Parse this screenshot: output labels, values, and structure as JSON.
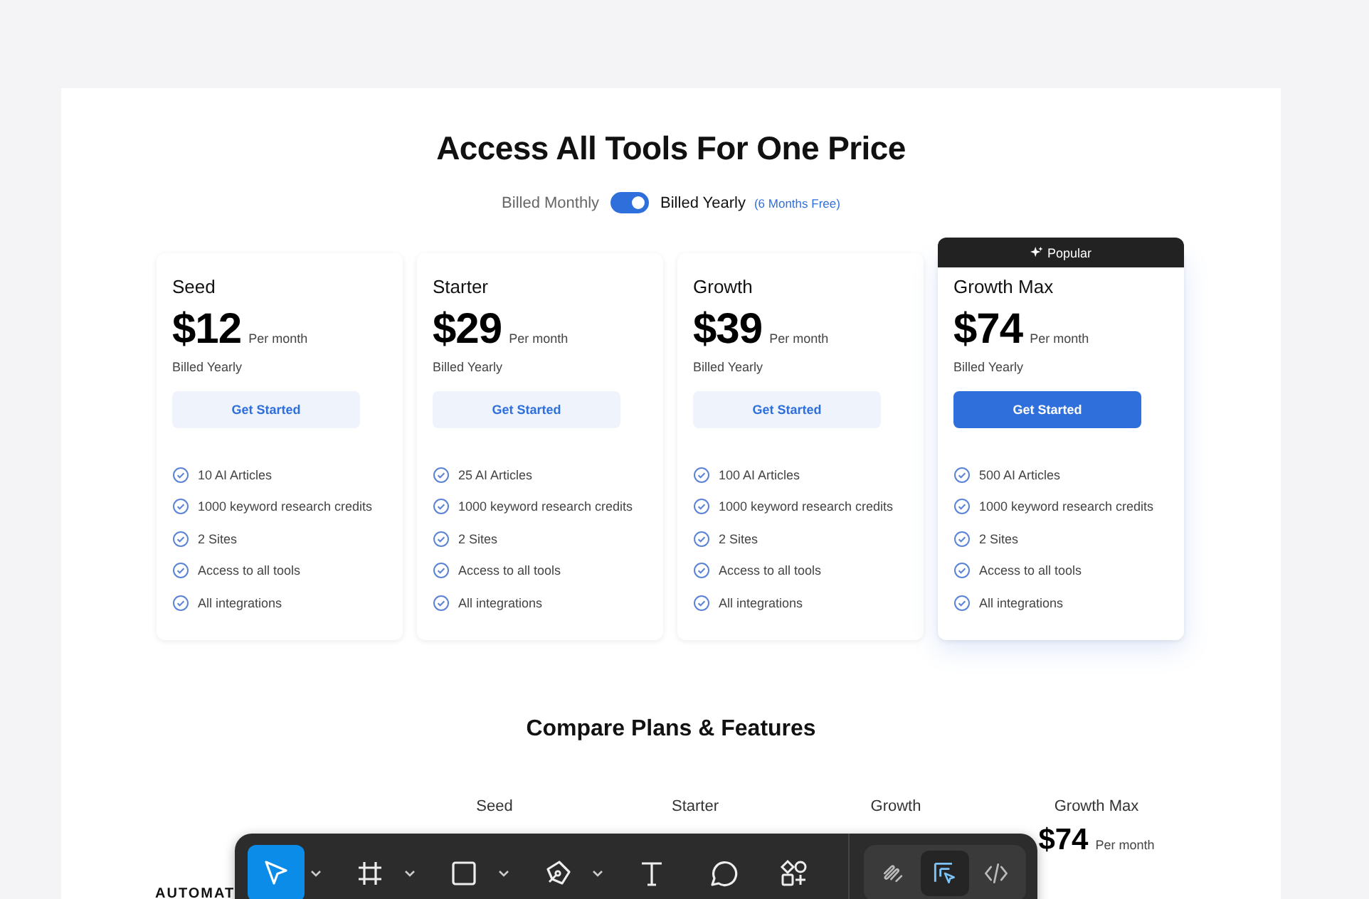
{
  "title": "Access All Tools For One Price",
  "billing": {
    "monthly_label": "Billed Monthly",
    "yearly_label": "Billed Yearly",
    "yearly_note": "(6 Months Free)",
    "on": true
  },
  "plans": [
    {
      "name": "Seed",
      "price": "$12",
      "period": "Per month",
      "billing": "Billed Yearly",
      "button": "Get Started",
      "highlighted": false,
      "features": [
        "10 AI Articles",
        "1000 keyword research credits",
        "2 Sites",
        "Access to all tools",
        "All integrations"
      ]
    },
    {
      "name": "Starter",
      "price": "$29",
      "period": "Per month",
      "billing": "Billed Yearly",
      "button": "Get Started",
      "highlighted": false,
      "features": [
        "25 AI Articles",
        "1000 keyword research credits",
        "2 Sites",
        "Access to all tools",
        "All integrations"
      ]
    },
    {
      "name": "Growth",
      "price": "$39",
      "period": "Per month",
      "billing": "Billed Yearly",
      "button": "Get Started",
      "highlighted": false,
      "features": [
        "100 AI Articles",
        "1000 keyword research credits",
        "2 Sites",
        "Access to all tools",
        "All integrations"
      ]
    },
    {
      "name": "Growth Max",
      "badge": "Popular",
      "price": "$74",
      "period": "Per month",
      "billing": "Billed Yearly",
      "button": "Get Started",
      "highlighted": true,
      "features": [
        "500 AI Articles",
        "1000 keyword research credits",
        "2 Sites",
        "Access to all tools",
        "All integrations"
      ]
    }
  ],
  "compare": {
    "title": "Compare Plans & Features",
    "columns": [
      {
        "name": "Seed"
      },
      {
        "name": "Starter"
      },
      {
        "name": "Growth"
      },
      {
        "name": "Growth Max",
        "price": "$74",
        "period": "Per month"
      }
    ],
    "row_label": "AUTOMAT"
  },
  "toolbar": {
    "tools": [
      {
        "kind": "pointer",
        "selected": true,
        "has_menu": true
      },
      {
        "kind": "frame",
        "selected": false,
        "has_menu": true
      },
      {
        "kind": "rectangle",
        "selected": false,
        "has_menu": true
      },
      {
        "kind": "pen",
        "selected": false,
        "has_menu": true
      },
      {
        "kind": "text",
        "selected": false,
        "has_menu": false
      },
      {
        "kind": "comment",
        "selected": false,
        "has_menu": false
      },
      {
        "kind": "components",
        "selected": false,
        "has_menu": false
      }
    ],
    "modes": [
      {
        "kind": "draw",
        "selected": false
      },
      {
        "kind": "design",
        "selected": true
      },
      {
        "kind": "dev",
        "selected": false
      }
    ]
  }
}
